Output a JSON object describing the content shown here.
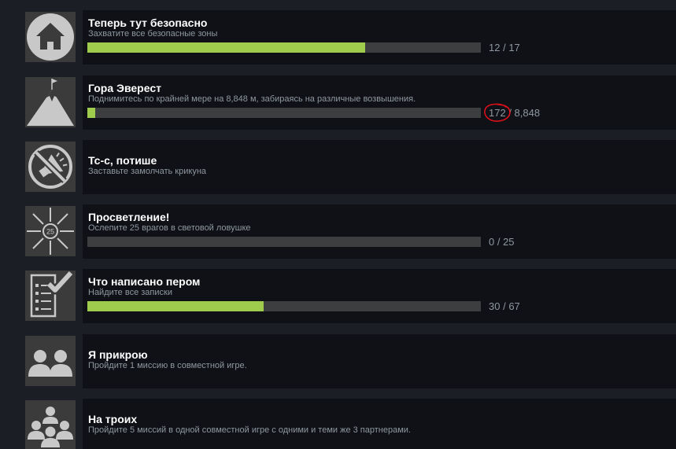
{
  "achievements": [
    {
      "icon": "house-icon",
      "title": "Теперь тут безопасно",
      "description": "Захватите все безопасные зоны",
      "progress": {
        "current": "12",
        "sep": " / ",
        "total": "17",
        "fraction": 0.706
      }
    },
    {
      "icon": "mountain-flag-icon",
      "title": "Гора Эверест",
      "description": "Поднимитесь по крайней мере на 8,848 м, забираясь на различные возвышения.",
      "progress": {
        "current": "172",
        "sep": " / ",
        "total": "8,848",
        "fraction": 0.02
      },
      "annotation": {
        "type": "hand-drawn-circle",
        "color": "#e0101a",
        "target": "current"
      }
    },
    {
      "icon": "muted-megaphone-icon",
      "title": "Тс-с, потише",
      "description": "Заставьте замолчать крикуна"
    },
    {
      "icon": "flash-burst-icon",
      "icon_text": "25",
      "title": "Просветление!",
      "description": "Ослепите 25 врагов в световой ловушке",
      "progress": {
        "current": "0",
        "sep": " / ",
        "total": "25",
        "fraction": 0
      }
    },
    {
      "icon": "checklist-icon",
      "title": "Что написано пером",
      "description": "Найдите все записки",
      "progress": {
        "current": "30",
        "sep": " / ",
        "total": "67",
        "fraction": 0.448
      }
    },
    {
      "icon": "two-players-icon",
      "title": "Я прикрою",
      "description": "Пройдите 1 миссию в совместной игре."
    },
    {
      "icon": "group-players-icon",
      "title": "На троих",
      "description": "Пройдите 5 миссий в одной совместной игре с одними и теми же 3 партнерами."
    }
  ],
  "colors": {
    "page_bg": "#1b1e24",
    "panel_bg": "#0f1116",
    "icon_bg": "#3b3b3b",
    "icon_fg": "#c8c8c8",
    "bar_track": "#3d3e40",
    "bar_fill": "#a0cc4e",
    "title": "#ffffff",
    "text_muted": "#8f98a0"
  }
}
